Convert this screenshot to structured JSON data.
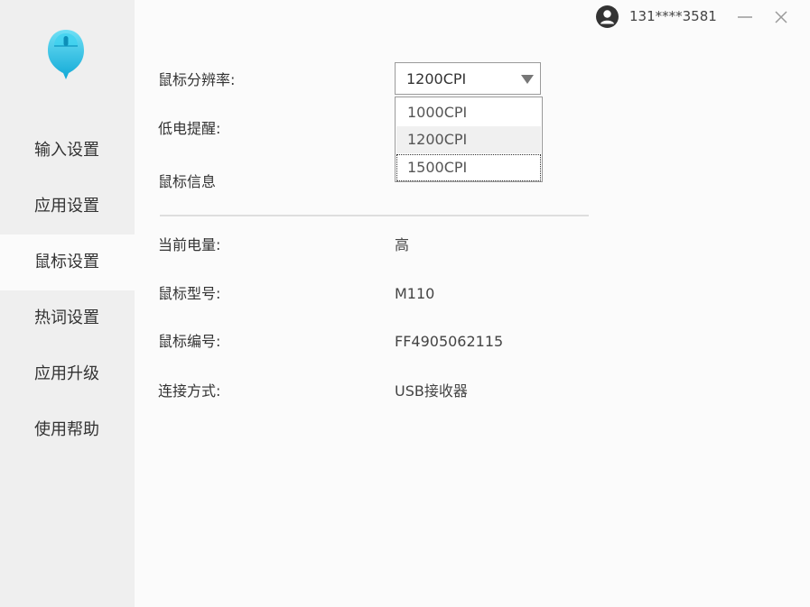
{
  "header": {
    "user_account": "131****3581"
  },
  "sidebar": {
    "logo_icon": "mouse-logo-icon",
    "items": [
      {
        "label": "输入设置",
        "active": false
      },
      {
        "label": "应用设置",
        "active": false
      },
      {
        "label": "鼠标设置",
        "active": true
      },
      {
        "label": "热词设置",
        "active": false
      },
      {
        "label": "应用升级",
        "active": false
      },
      {
        "label": "使用帮助",
        "active": false
      }
    ]
  },
  "settings": {
    "resolution_label": "鼠标分辨率:",
    "resolution_value": "1200CPI",
    "resolution_options": [
      "1000CPI",
      "1200CPI",
      "1500CPI"
    ],
    "low_battery_label": "低电提醒:",
    "mouse_info_label": "鼠标信息"
  },
  "info": {
    "battery_label": "当前电量:",
    "battery_value": "高",
    "model_label": "鼠标型号:",
    "model_value": "M110",
    "serial_label": "鼠标编号:",
    "serial_value": "FF4905062115",
    "connection_label": "连接方式:",
    "connection_value": "USB接收器"
  },
  "colors": {
    "brand": "#28c3e8",
    "sidebar_bg": "#efefef",
    "content_bg": "#fbfbfb"
  }
}
